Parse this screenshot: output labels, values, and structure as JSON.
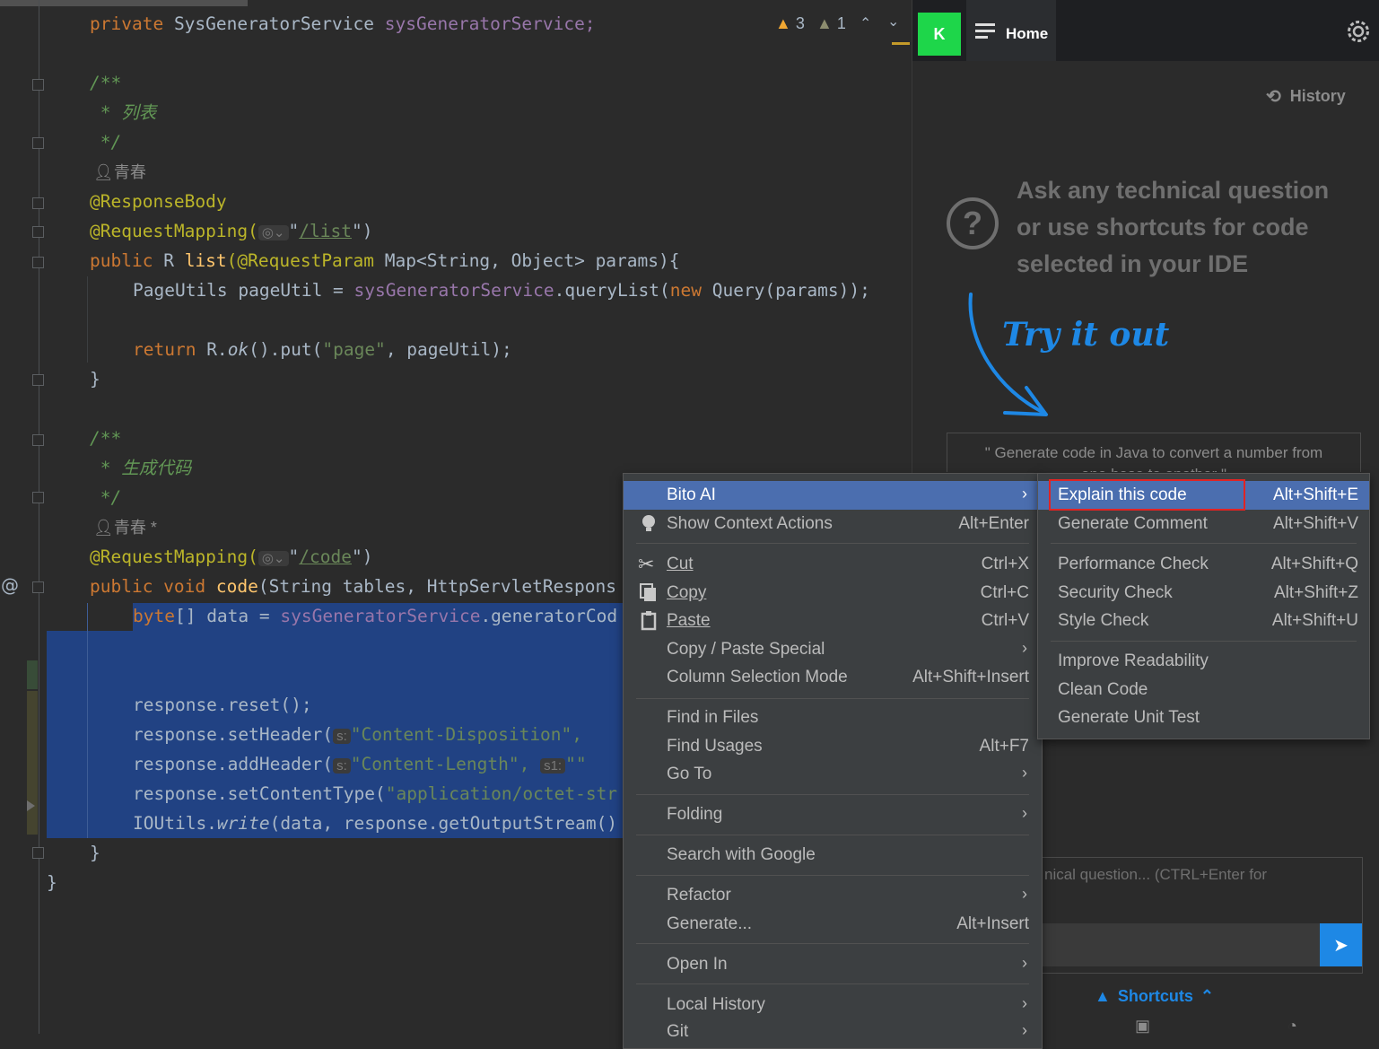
{
  "editor": {
    "warnings": {
      "warning_count": "3",
      "weak_warning_count": "1"
    },
    "lines": {
      "l1_kw": "private",
      "l1_type": "SysGeneratorService",
      "l1_field": "sysGeneratorService;",
      "c1_open": "/**",
      "c1_text": " * 列表",
      "c1_close": " */",
      "author1": "青春",
      "ann_response_body": "@ResponseBody",
      "ann_request_mapping": "@RequestMapping(",
      "url_list": "/list",
      "list_sig_kw": "public",
      "list_sig_type": " R ",
      "list_sig_fn": "list",
      "list_sig_ann": "(@RequestParam",
      "list_sig_rest": " Map<String, Object> params){",
      "page_util_a": "PageUtils pageUtil = ",
      "page_util_field": "sysGeneratorService",
      "page_util_b": ".queryList(",
      "page_util_new": "new",
      "page_util_c": " Query(params));",
      "return_kw": "return",
      "return_a": " R.",
      "return_ok": "ok",
      "return_b": "().put(",
      "return_str": "\"page\"",
      "return_c": ", pageUtil);",
      "close_brace": "}",
      "c2_open": "/**",
      "c2_text": " * 生成代码",
      "c2_close": " */",
      "author2": "青春 *",
      "url_code": "/code",
      "code_sig_kw": "public void",
      "code_sig_fn": "code",
      "code_sig_rest": "(String tables, HttpServletRespons",
      "byte_kw": "byte",
      "byte_a": "[] data = ",
      "byte_field": "sysGeneratorService",
      "byte_b": ".generatorCod",
      "reset": "response.reset();",
      "set_header": "response.setHeader(",
      "set_header_hint": "s:",
      "set_header_str": "\"Content-Disposition\",",
      "add_header": "response.addHeader(",
      "add_header_hint": "s:",
      "add_header_str": "\"Content-Length\",",
      "add_header_hint2": "s1:",
      "add_header_str2": "\"\"",
      "content_type": "response.setContentType(",
      "content_type_str": "\"application/octet-str",
      "ioutils_a": "IOUtils.",
      "ioutils_write": "write",
      "ioutils_b": "(data, response.getOutputStream()",
      "class_close": "}",
      "at_marker": "@"
    }
  },
  "bito_panel": {
    "avatar_letter": "K",
    "home_label": "Home",
    "history_label": "History",
    "prompt_text_line1": "Ask any technical question",
    "prompt_text_line2": "or use shortcuts for code",
    "prompt_text_line3": "selected in your IDE",
    "try_it_out": "Try it out",
    "example_line1": "\" Generate code in Java to convert a number from",
    "example_line2": "one base to another \"",
    "input_placeholder": "nical question... (CTRL+Enter for",
    "shortcuts_label": "Shortcuts",
    "accent_color": "#1e88e5"
  },
  "context_menu": {
    "items": [
      {
        "label": "Bito AI",
        "shortcut": "",
        "submenu": true
      },
      {
        "label": "Show Context Actions",
        "shortcut": "Alt+Enter",
        "icon": "lightbulb-icon"
      },
      {
        "label": "Cut",
        "shortcut": "Ctrl+X",
        "icon": "scissors-icon"
      },
      {
        "label": "Copy",
        "shortcut": "Ctrl+C",
        "icon": "copy-icon"
      },
      {
        "label": "Paste",
        "shortcut": "Ctrl+V",
        "icon": "clipboard-icon"
      },
      {
        "label": "Copy / Paste Special",
        "shortcut": "",
        "submenu": true
      },
      {
        "label": "Column Selection Mode",
        "shortcut": "Alt+Shift+Insert"
      },
      {
        "label": "Find in Files",
        "shortcut": ""
      },
      {
        "label": "Find Usages",
        "shortcut": "Alt+F7"
      },
      {
        "label": "Go To",
        "shortcut": "",
        "submenu": true
      },
      {
        "label": "Folding",
        "shortcut": "",
        "submenu": true
      },
      {
        "label": "Search with Google",
        "shortcut": ""
      },
      {
        "label": "Refactor",
        "shortcut": "",
        "submenu": true
      },
      {
        "label": "Generate...",
        "shortcut": "Alt+Insert"
      },
      {
        "label": "Open In",
        "shortcut": "",
        "submenu": true
      },
      {
        "label": "Local History",
        "shortcut": "",
        "submenu": true
      },
      {
        "label": "Git",
        "shortcut": "",
        "submenu": true
      }
    ]
  },
  "bito_submenu": {
    "items": [
      {
        "label": "Explain this code",
        "shortcut": "Alt+Shift+E"
      },
      {
        "label": "Generate Comment",
        "shortcut": "Alt+Shift+V"
      },
      {
        "label": "Performance Check",
        "shortcut": "Alt+Shift+Q"
      },
      {
        "label": "Security Check",
        "shortcut": "Alt+Shift+Z"
      },
      {
        "label": "Style Check",
        "shortcut": "Alt+Shift+U"
      },
      {
        "label": "Improve Readability",
        "shortcut": ""
      },
      {
        "label": "Clean Code",
        "shortcut": ""
      },
      {
        "label": "Generate Unit Test",
        "shortcut": ""
      }
    ]
  }
}
